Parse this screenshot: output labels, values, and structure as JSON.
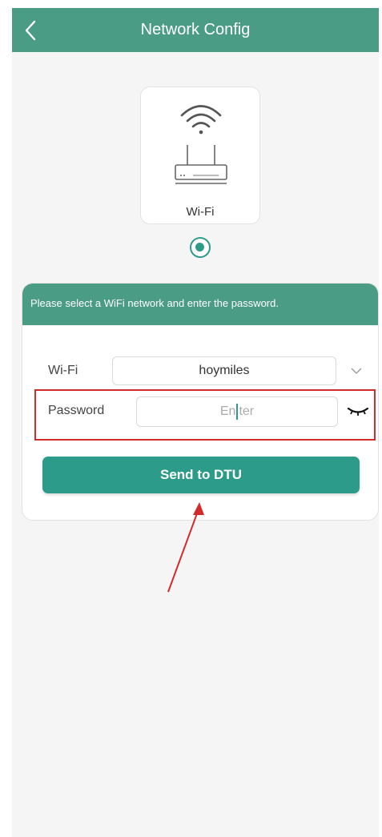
{
  "header": {
    "title": "Network Config",
    "background_color": "#4b9c85"
  },
  "network_type": {
    "label": "Wi-Fi",
    "icon": "wifi-router-icon",
    "selected": true
  },
  "config": {
    "instruction": "Please select a WiFi network and enter the password.",
    "wifi_label": "Wi-Fi",
    "wifi_value": "hoymiles",
    "password_label": "Password",
    "password_placeholder": "Enter",
    "send_button_label": "Send to DTU",
    "accent_color": "#2d9b89"
  },
  "annotation": {
    "highlight_color": "#d22b2b"
  }
}
